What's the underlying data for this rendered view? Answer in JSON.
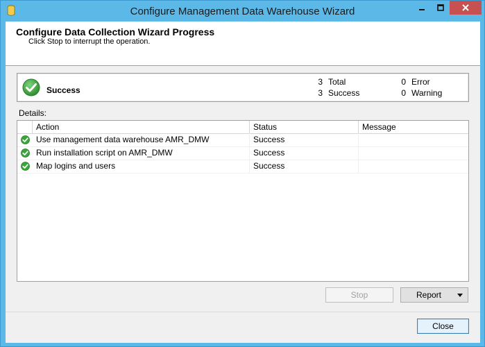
{
  "window": {
    "title": "Configure Management Data Warehouse Wizard"
  },
  "header": {
    "title": "Configure Data Collection Wizard Progress",
    "subtitle": "Click Stop to interrupt the operation."
  },
  "summary": {
    "status": "Success",
    "total_count": "3",
    "total_label": "Total",
    "success_count": "3",
    "success_label": "Success",
    "error_count": "0",
    "error_label": "Error",
    "warning_count": "0",
    "warning_label": "Warning"
  },
  "details": {
    "label": "Details:",
    "columns": [
      "Action",
      "Status",
      "Message"
    ],
    "rows": [
      {
        "action": "Use management data warehouse AMR_DMW",
        "status": "Success",
        "message": ""
      },
      {
        "action": "Run installation script on AMR_DMW",
        "status": "Success",
        "message": ""
      },
      {
        "action": "Map logins and users",
        "status": "Success",
        "message": ""
      }
    ]
  },
  "buttons": {
    "stop": "Stop",
    "report": "Report",
    "close": "Close"
  },
  "colors": {
    "success_green": "#3aa63a",
    "close_button_red": "#c75050",
    "title_bar": "#5cb8e6"
  }
}
